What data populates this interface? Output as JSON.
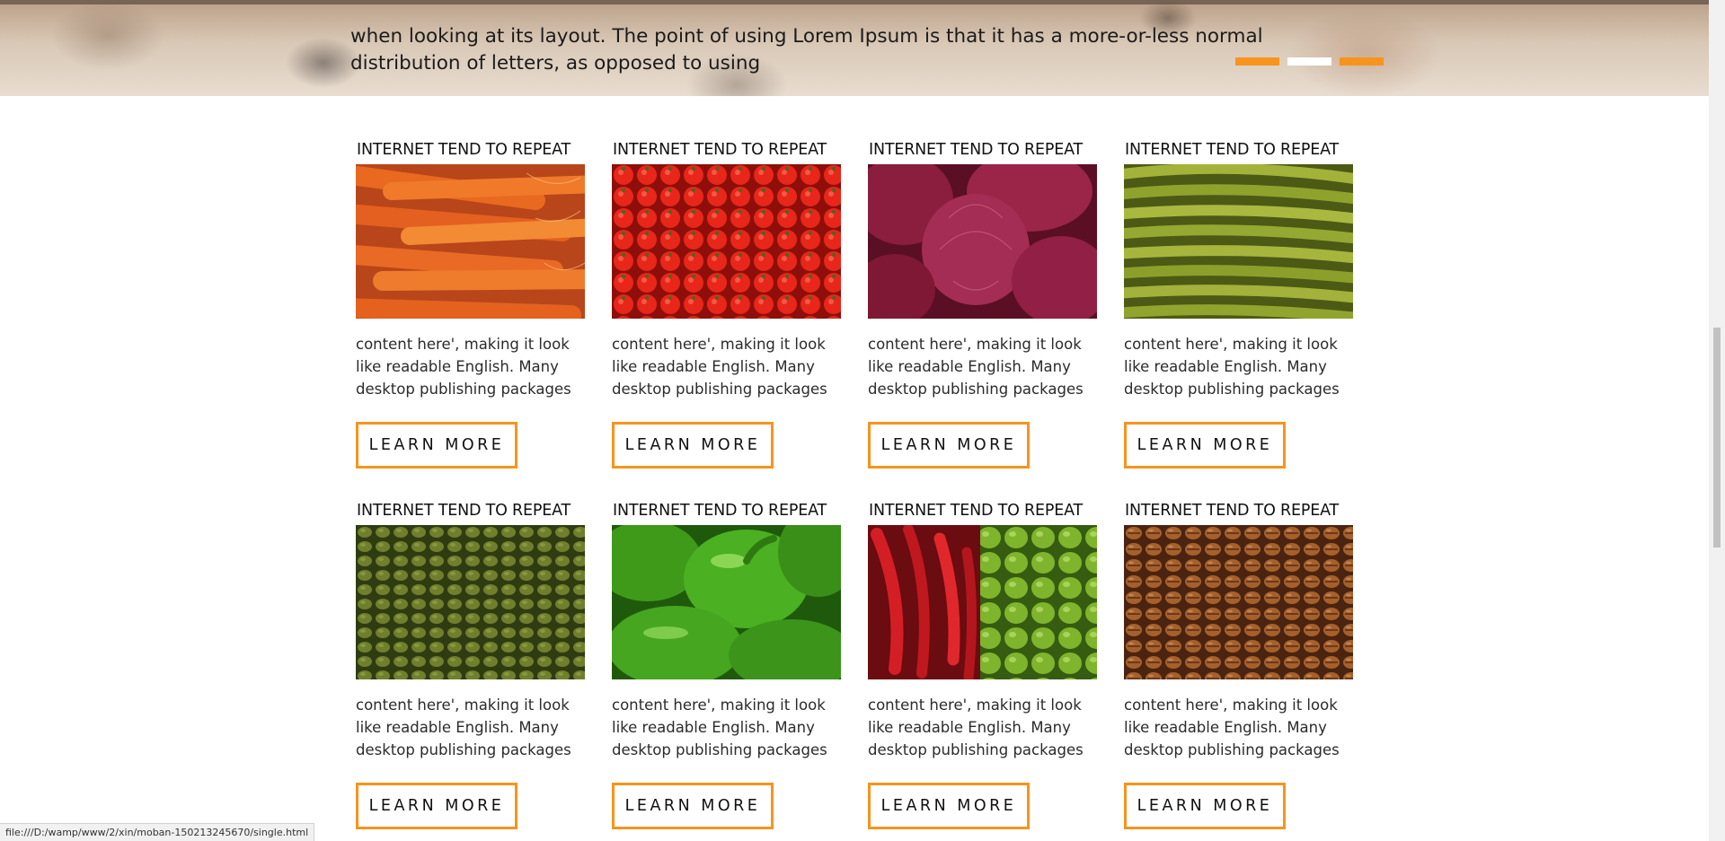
{
  "hero": {
    "text": "when looking at its layout. The point of using Lorem Ipsum is that it has a more-or-less normal distribution of letters, as opposed to using",
    "active_dot": 1,
    "dot_colors": {
      "active": "#ffffff",
      "inactive": "#f7941d"
    }
  },
  "accent_color": "#f7941d",
  "products": [
    {
      "title": "INTERNET TEND TO REPEAT",
      "image": "carrots",
      "text": "content here', making it look like readable English. Many desktop publishing packages",
      "button": "LEARN MORE"
    },
    {
      "title": "INTERNET TEND TO REPEAT",
      "image": "cherry-tomatoes",
      "text": "content here', making it look like readable English. Many desktop publishing packages",
      "button": "LEARN MORE"
    },
    {
      "title": "INTERNET TEND TO REPEAT",
      "image": "red-onions",
      "text": "content here', making it look like readable English. Many desktop publishing packages",
      "button": "LEARN MORE"
    },
    {
      "title": "INTERNET TEND TO REPEAT",
      "image": "green-beans",
      "text": "content here', making it look like readable English. Many desktop publishing packages",
      "button": "LEARN MORE"
    },
    {
      "title": "INTERNET TEND TO REPEAT",
      "image": "green-peas",
      "text": "content here', making it look like readable English. Many desktop publishing packages",
      "button": "LEARN MORE"
    },
    {
      "title": "INTERNET TEND TO REPEAT",
      "image": "green-peppers",
      "text": "content here', making it look like readable English. Many desktop publishing packages",
      "button": "LEARN MORE"
    },
    {
      "title": "INTERNET TEND TO REPEAT",
      "image": "red-and-green-chilies",
      "text": "content here', making it look like readable English. Many desktop publishing packages",
      "button": "LEARN MORE"
    },
    {
      "title": "INTERNET TEND TO REPEAT",
      "image": "coffee-beans",
      "text": "content here', making it look like readable English. Many desktop publishing packages",
      "button": "LEARN MORE"
    }
  ],
  "status_bar": {
    "url": "file:///D:/wamp/www/2/xin/moban-150213245670/single.html"
  }
}
